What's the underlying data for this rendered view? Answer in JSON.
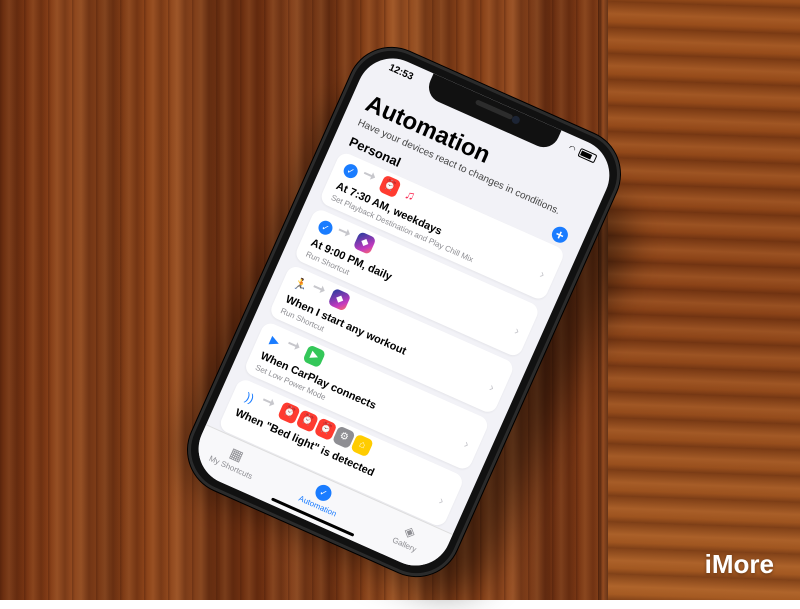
{
  "status": {
    "time": "12:53"
  },
  "header": {
    "title": "Automation",
    "subtitle": "Have your devices react to changes in conditions.",
    "section": "Personal",
    "add_symbol": "+"
  },
  "automations": [
    {
      "name": "At 7:30 AM, weekdays",
      "detail": "Set Playback Destination and Play Chill Mix",
      "icons": [
        "clock-icon",
        "music-icon"
      ]
    },
    {
      "name": "At 9:00 PM, daily",
      "detail": "Run Shortcut",
      "icons": [
        "shortcuts-icon"
      ]
    },
    {
      "name": "When I start any workout",
      "detail": "Run Shortcut",
      "icons": [
        "shortcuts-icon"
      ]
    },
    {
      "name": "When CarPlay connects",
      "detail": "Set Low Power Mode",
      "icons": [
        "carplay-icon"
      ]
    },
    {
      "name": "When \"Bed light\" is detected",
      "detail": "",
      "icons": [
        "clock-icon",
        "clock-icon",
        "clock-icon",
        "settings-icon",
        "home-icon"
      ]
    }
  ],
  "tabs": [
    {
      "label": "My Shortcuts",
      "icon": "grid-icon"
    },
    {
      "label": "Automation",
      "icon": "check-icon",
      "active": true
    },
    {
      "label": "Gallery",
      "icon": "layers-icon"
    }
  ],
  "watermark": "iMore",
  "colors": {
    "accent": "#1a7cff",
    "wood": "#8e4419"
  }
}
